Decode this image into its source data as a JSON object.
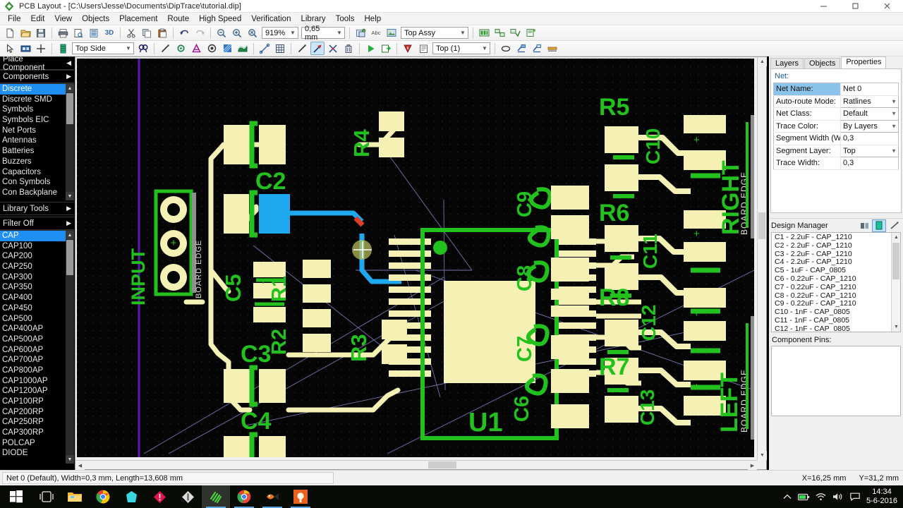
{
  "window": {
    "title": "PCB Layout - [C:\\Users\\Jesse\\Documents\\DipTrace\\tutorial.dip]",
    "minimize": "–",
    "maximize": "❐",
    "close": "✕"
  },
  "menubar": {
    "items": [
      {
        "label": "File"
      },
      {
        "label": "Edit"
      },
      {
        "label": "View"
      },
      {
        "label": "Objects"
      },
      {
        "label": "Placement"
      },
      {
        "label": "Route"
      },
      {
        "label": "High Speed"
      },
      {
        "label": "Verification"
      },
      {
        "label": "Library"
      },
      {
        "label": "Tools"
      },
      {
        "label": "Help"
      }
    ]
  },
  "toolbar_main": {
    "zoom_value": "919%",
    "grid_value": "0,65 mm",
    "layer_value": "Top Assy",
    "buttons": [
      {
        "name": "new-file-icon",
        "tip": "New"
      },
      {
        "name": "open-file-icon",
        "tip": "Open"
      },
      {
        "name": "save-file-icon",
        "tip": "Save"
      },
      {
        "name": "print-icon",
        "tip": "Print"
      },
      {
        "name": "print-preview-icon",
        "tip": "Print Preview"
      },
      {
        "name": "page-setup-icon",
        "tip": "Page Setup"
      },
      {
        "name": "view-3d-icon",
        "tip": "3D Preview"
      },
      {
        "name": "cut-icon",
        "tip": "Cut"
      },
      {
        "name": "copy-icon",
        "tip": "Copy"
      },
      {
        "name": "paste-icon",
        "tip": "Paste"
      },
      {
        "name": "undo-icon",
        "tip": "Undo"
      },
      {
        "name": "redo-icon",
        "tip": "Redo"
      },
      {
        "name": "zoom-out-icon",
        "tip": "Zoom Out"
      },
      {
        "name": "zoom-in-icon",
        "tip": "Zoom In"
      },
      {
        "name": "zoom-fit-icon",
        "tip": "Zoom to Fit"
      }
    ]
  },
  "toolbar_objects": {
    "side_value": "Top Side",
    "toplayer_value": "Top (1)",
    "buttons": [
      {
        "name": "select-arrow-icon"
      },
      {
        "name": "component-icon"
      },
      {
        "name": "crosshair-icon"
      },
      {
        "name": "layer-stack-icon"
      },
      {
        "name": "find-icon"
      },
      {
        "name": "route-manual-icon"
      },
      {
        "name": "via-icon"
      },
      {
        "name": "net-port-icon"
      },
      {
        "name": "pad-icon"
      },
      {
        "name": "copper-pour-icon"
      },
      {
        "name": "polygon-icon"
      },
      {
        "name": "measure-icon"
      },
      {
        "name": "grid-toggle-icon"
      },
      {
        "name": "trace-icon"
      },
      {
        "name": "route-tool-icon"
      },
      {
        "name": "cut-trace-icon"
      },
      {
        "name": "delete-trace-icon"
      },
      {
        "name": "autoroute-run-icon"
      },
      {
        "name": "route-setup-icon"
      },
      {
        "name": "drc-icon"
      },
      {
        "name": "report-icon"
      },
      {
        "name": "teardrop-icon"
      },
      {
        "name": "copper-top-icon"
      },
      {
        "name": "copper-bottom-icon"
      },
      {
        "name": "smd-icon"
      }
    ]
  },
  "left_panel": {
    "place_component_label": "Place Component",
    "components_label": "Components",
    "library_tools_label": "Library Tools",
    "filter_label": "Filter Off",
    "categories": [
      "Discrete",
      "Discrete SMD",
      "Symbols",
      "Symbols EIC",
      "Net Ports",
      "Antennas",
      "Batteries",
      "Buzzers",
      "Capacitors",
      "Con Symbols",
      "Con Backplane"
    ],
    "selected_category": "Discrete",
    "parts": [
      "CAP",
      "CAP100",
      "CAP200",
      "CAP250",
      "CAP300",
      "CAP350",
      "CAP400",
      "CAP450",
      "CAP500",
      "CAP400AP",
      "CAP500AP",
      "CAP600AP",
      "CAP700AP",
      "CAP800AP",
      "CAP1000AP",
      "CAP1200AP",
      "CAP100RP",
      "CAP200RP",
      "CAP250RP",
      "CAP300RP",
      "POLCAP",
      "DIODE"
    ],
    "selected_part": "CAP"
  },
  "right_panel": {
    "tabs": [
      {
        "label": "Layers",
        "active": false
      },
      {
        "label": "Objects",
        "active": false
      },
      {
        "label": "Properties",
        "active": true
      }
    ],
    "section_label": "Net:",
    "properties": [
      {
        "key": "Net Name:",
        "value": "Net 0",
        "dropdown": false,
        "highlight": true
      },
      {
        "key": "Auto-route Mode:",
        "value": "Ratlines",
        "dropdown": true,
        "highlight": false
      },
      {
        "key": "Net Class:",
        "value": "Default",
        "dropdown": true,
        "highlight": false
      },
      {
        "key": "Trace Color:",
        "value": "By Layers",
        "dropdown": true,
        "highlight": false
      },
      {
        "key": "Segment Width (W):",
        "value": "0,3",
        "dropdown": false,
        "highlight": false
      },
      {
        "key": "Segment Layer:",
        "value": "Top",
        "dropdown": true,
        "highlight": false
      },
      {
        "key": "Trace Width:",
        "value": "0,3",
        "dropdown": false,
        "highlight": false
      }
    ],
    "design_manager": {
      "title": "Design Manager",
      "buttons": [
        {
          "name": "dm-components-icon",
          "active": false
        },
        {
          "name": "dm-nets-icon",
          "active": true
        },
        {
          "name": "dm-errors-icon",
          "active": false
        }
      ],
      "items": [
        "C1 - 2.2uF - CAP_1210",
        "C2 - 2.2uF - CAP_1210",
        "C3 - 2.2uF - CAP_1210",
        "C4 - 2.2uF - CAP_1210",
        "C5 - 1uF - CAP_0805",
        "C6 - 0.22uF - CAP_1210",
        "C7 - 0.22uF - CAP_1210",
        "C8 - 0.22uF - CAP_1210",
        "C9 - 0.22uF - CAP_1210",
        "C10 - 1nF - CAP_0805",
        "C11 - 1nF - CAP_0805",
        "C12 - 1nF - CAP_0805"
      ]
    },
    "component_pins_label": "Component Pins:"
  },
  "statusbar": {
    "message": "Net 0 (Default), Width=0,3 mm, Length=13,608 mm",
    "x_coord": "X=16,25 mm",
    "y_coord": "Y=31,2 mm"
  },
  "taskbar": {
    "icons": [
      {
        "name": "start-button-icon"
      },
      {
        "name": "task-view-icon"
      },
      {
        "name": "file-explorer-icon"
      },
      {
        "name": "chrome-icon"
      },
      {
        "name": "app-teal-icon"
      },
      {
        "name": "app-red-diamond-icon"
      },
      {
        "name": "app-white-diamond-icon"
      },
      {
        "name": "diptrace-icon"
      },
      {
        "name": "chrome-window-icon"
      },
      {
        "name": "app-orange-fish-icon"
      },
      {
        "name": "app-orange-square-icon"
      }
    ],
    "tray": [
      {
        "name": "show-hidden-icons-icon"
      },
      {
        "name": "battery-icon"
      },
      {
        "name": "wifi-icon"
      },
      {
        "name": "volume-icon"
      },
      {
        "name": "action-center-icon"
      }
    ],
    "clock_time": "14:34",
    "clock_date": "5-6-2016"
  },
  "pcb": {
    "background_color": "#050505",
    "pad_color": "#F5F0B4",
    "silkscreen_color": "#22C11E",
    "selected_trace_color": "#1EA8F0",
    "ratline_color": "#8a86c8",
    "board_outline_color": "#5b16b5",
    "designators": [
      "C2",
      "C3",
      "C4",
      "C5",
      "C9",
      "C10",
      "C11",
      "C12",
      "C13",
      "R1",
      "R2",
      "R3",
      "R4",
      "R5",
      "R6",
      "R7",
      "R8",
      "U1"
    ],
    "text_labels": [
      "INPUT",
      "BOARD EDGE",
      "RIGHT",
      "LEFT",
      "U1"
    ]
  }
}
